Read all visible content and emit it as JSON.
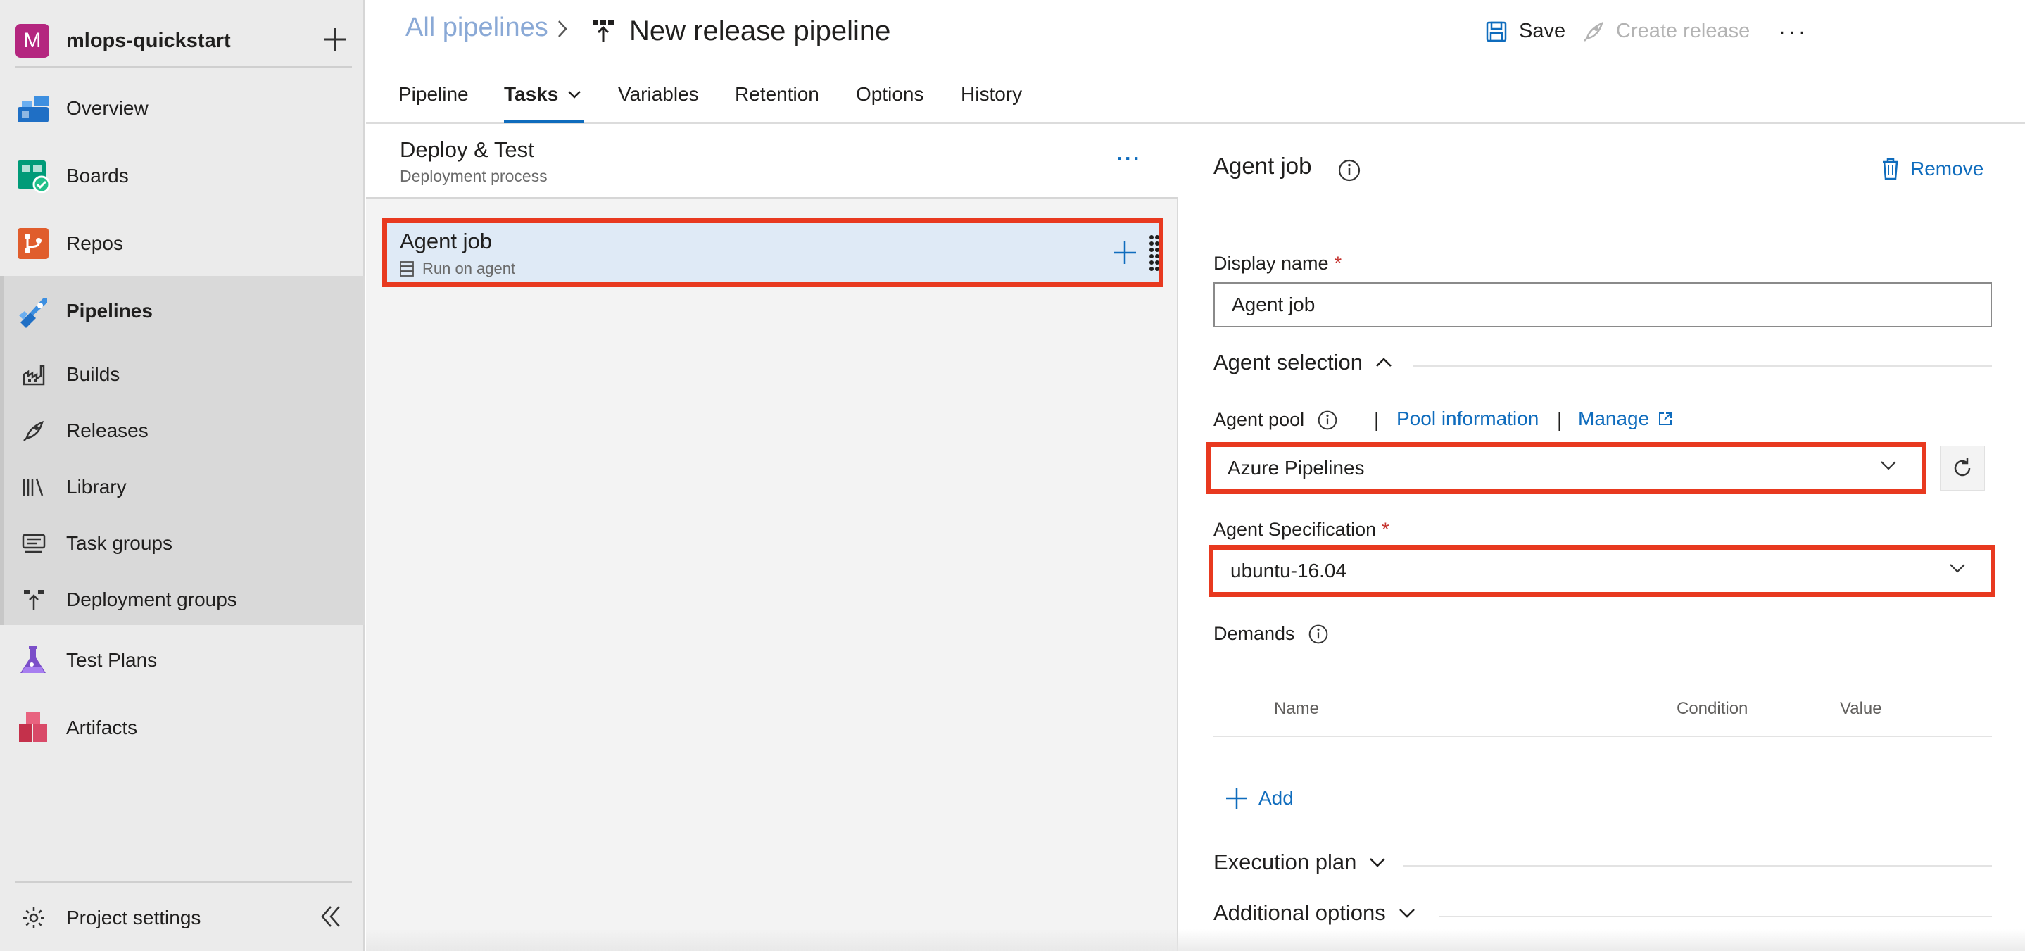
{
  "org": {
    "avatar_letter": "M",
    "name": "mlops-quickstart"
  },
  "sidebar": {
    "items": [
      {
        "label": "Overview",
        "icon": "overview-icon"
      },
      {
        "label": "Boards",
        "icon": "boards-icon"
      },
      {
        "label": "Repos",
        "icon": "repos-icon"
      },
      {
        "label": "Pipelines",
        "icon": "pipelines-icon"
      },
      {
        "label": "Builds",
        "icon": "builds-icon"
      },
      {
        "label": "Releases",
        "icon": "releases-icon"
      },
      {
        "label": "Library",
        "icon": "library-icon"
      },
      {
        "label": "Task groups",
        "icon": "task-groups-icon"
      },
      {
        "label": "Deployment groups",
        "icon": "deployment-groups-icon"
      },
      {
        "label": "Test Plans",
        "icon": "test-plans-icon"
      },
      {
        "label": "Artifacts",
        "icon": "artifacts-icon"
      }
    ],
    "footer": {
      "label": "Project settings"
    }
  },
  "header": {
    "breadcrumb": "All pipelines",
    "title": "New release pipeline",
    "save_label": "Save",
    "create_release_label": "Create release",
    "more": "···",
    "tabs": [
      {
        "label": "Pipeline"
      },
      {
        "label": "Tasks"
      },
      {
        "label": "Variables"
      },
      {
        "label": "Retention"
      },
      {
        "label": "Options"
      },
      {
        "label": "History"
      }
    ]
  },
  "stage": {
    "title": "Deploy & Test",
    "subtitle": "Deployment process",
    "more": "···",
    "job": {
      "title": "Agent job",
      "subtitle": "Run on agent"
    }
  },
  "panel": {
    "title": "Agent job",
    "remove_label": "Remove",
    "display_name_label": "Display name",
    "display_name_value": "Agent job",
    "required_mark": "*",
    "agent_selection_label": "Agent selection",
    "agent_pool_label": "Agent pool",
    "pool_information_label": "Pool information",
    "manage_label": "Manage",
    "agent_pool_value": "Azure Pipelines",
    "agent_spec_label": "Agent Specification",
    "agent_spec_value": "ubuntu-16.04",
    "demands_label": "Demands",
    "demands_columns": {
      "name": "Name",
      "condition": "Condition",
      "value": "Value"
    },
    "add_label": "Add",
    "execution_plan_label": "Execution plan",
    "additional_options_label": "Additional options"
  },
  "colors": {
    "accent": "#0f6cbd",
    "highlight": "#e8391f",
    "sidebar_bg": "#ebebeb",
    "required": "#c4312c"
  }
}
